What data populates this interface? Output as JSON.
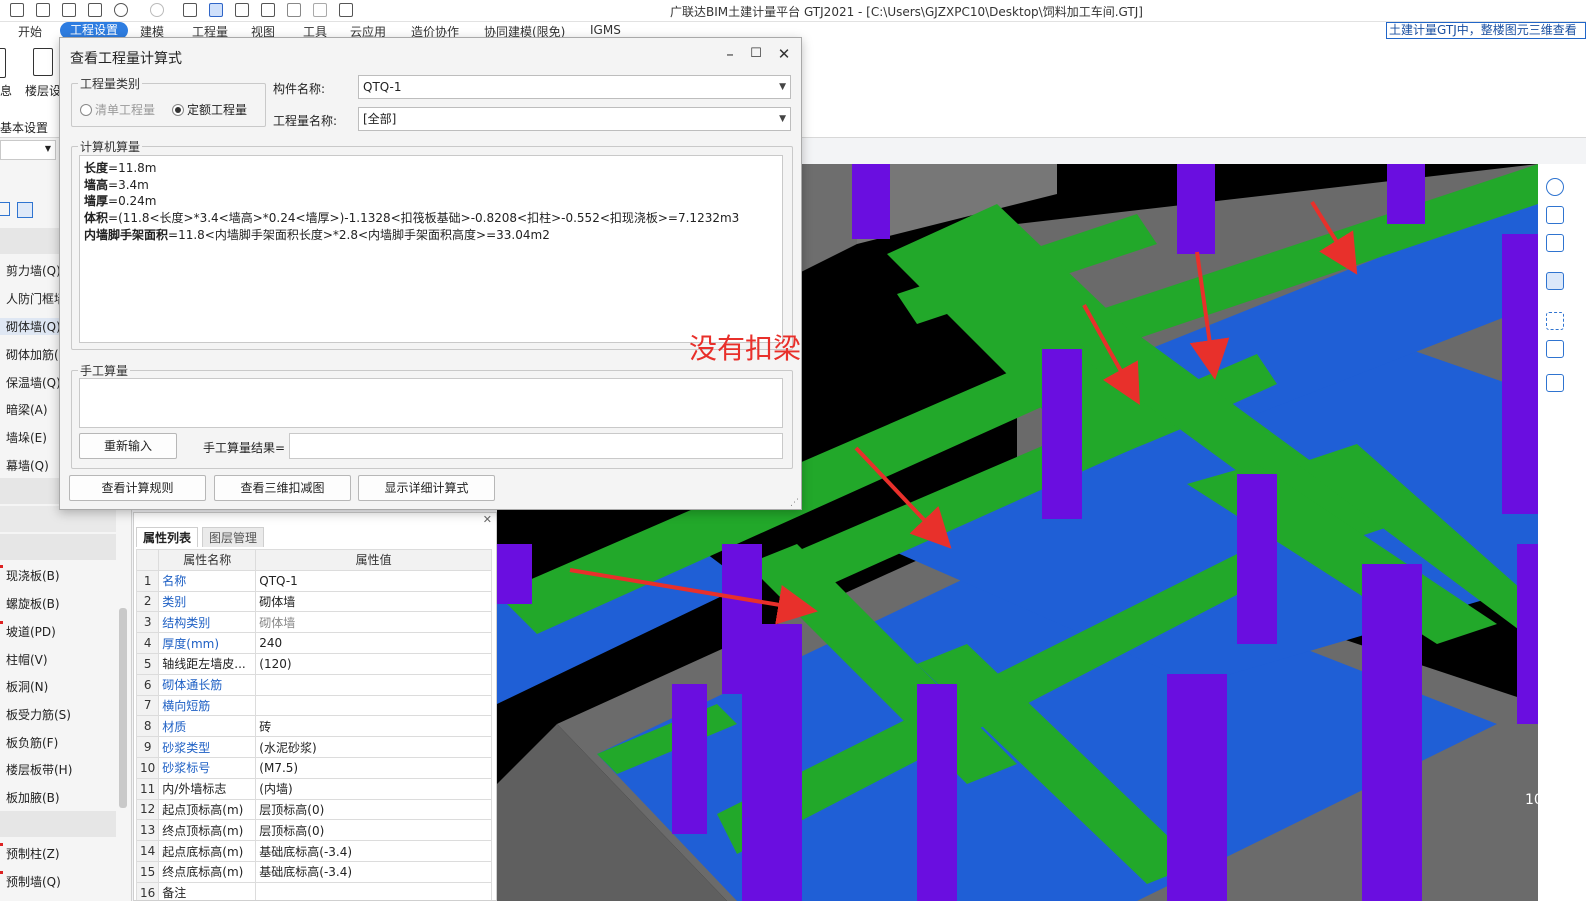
{
  "window": {
    "title": "广联达BIM土建计量平台 GTJ2021 - [C:\\Users\\GJZXPC10\\Desktop\\饲料加工车间.GTJ]"
  },
  "menu": [
    "开始",
    "工程设置",
    "建模",
    "工程量",
    "视图",
    "工具",
    "云应用",
    "造价协作",
    "协同建模(限免)",
    "IGMS"
  ],
  "menu_active": "工程设置",
  "hint_text": "土建计量GTJ中，整楼图元三维查看",
  "ribbon": {
    "items": [
      "息",
      "楼层设"
    ],
    "group_label": "基本设置"
  },
  "left_panel": {
    "items": [
      "剪力墙(Q)",
      "人防门框墙",
      "砌体墙(Q)",
      "砌体加筋(",
      "保温墙(Q)",
      "暗梁(A)",
      "墙垛(E)",
      "幕墙(Q)",
      "现浇板(B)",
      "螺旋板(B)",
      "坡道(PD)",
      "柱帽(V)",
      "板洞(N)",
      "板受力筋(S)",
      "板负筋(F)",
      "楼层板带(H)",
      "板加腋(B)",
      "预制柱(Z)",
      "预制墙(Q)"
    ],
    "selected": "砌体墙(Q)"
  },
  "dialog": {
    "title": "查看工程量计算式",
    "category_legend": "工程量类别",
    "radio_list": "清单工程量",
    "radio_quota": "定额工程量",
    "component_label": "构件名称:",
    "component_value": "QTQ-1",
    "quantity_label": "工程量名称:",
    "quantity_value": "[全部]",
    "computed_legend": "计算机算量",
    "lines": [
      {
        "name": "长度",
        "expr": "=11.8m"
      },
      {
        "name": "墙高",
        "expr": "=3.4m"
      },
      {
        "name": "墙厚",
        "expr": "=0.24m"
      },
      {
        "name": "体积",
        "expr": "=(11.8<长度>*3.4<墙高>*0.24<墙厚>)-1.1328<扣筏板基础>-0.8208<扣柱>-0.552<扣现浇板>=7.1232m3"
      },
      {
        "name": "内墙脚手架面积",
        "expr": "=11.8<内墙脚手架面积长度>*2.8<内墙脚手架面积高度>=33.04m2"
      }
    ],
    "manual_legend": "手工算量",
    "reinput_btn": "重新输入",
    "manual_result_label": "手工算量结果=",
    "btn_rules": "查看计算规则",
    "btn_3d": "查看三维扣减图",
    "btn_detail": "显示详细计算式"
  },
  "annotation": "没有扣梁",
  "props": {
    "tab_props": "属性列表",
    "tab_layers": "图层管理",
    "col_name": "属性名称",
    "col_value": "属性值",
    "rows": [
      {
        "n": "1",
        "name": "名称",
        "value": "QTQ-1",
        "blue": true
      },
      {
        "n": "2",
        "name": "类别",
        "value": "砌体墙",
        "blue": true
      },
      {
        "n": "3",
        "name": "结构类别",
        "value": "砌体墙",
        "blue": true,
        "gray": true
      },
      {
        "n": "4",
        "name": "厚度(mm)",
        "value": "240",
        "blue": true
      },
      {
        "n": "5",
        "name": "轴线距左墙皮...",
        "value": "(120)",
        "blue": false
      },
      {
        "n": "6",
        "name": "砌体通长筋",
        "value": "",
        "blue": true
      },
      {
        "n": "7",
        "name": "横向短筋",
        "value": "",
        "blue": true
      },
      {
        "n": "8",
        "name": "材质",
        "value": "砖",
        "blue": true
      },
      {
        "n": "9",
        "name": "砂浆类型",
        "value": "(水泥砂浆)",
        "blue": true
      },
      {
        "n": "10",
        "name": "砂浆标号",
        "value": "(M7.5)",
        "blue": true
      },
      {
        "n": "11",
        "name": "内/外墙标志",
        "value": "(内墙)",
        "blue": false
      },
      {
        "n": "12",
        "name": "起点顶标高(m)",
        "value": "层顶标高(0)",
        "blue": false
      },
      {
        "n": "13",
        "name": "终点顶标高(m)",
        "value": "层顶标高(0)",
        "blue": false
      },
      {
        "n": "14",
        "name": "起点底标高(m)",
        "value": "基础底标高(-3.4)",
        "blue": false
      },
      {
        "n": "15",
        "name": "终点底标高(m)",
        "value": "基础底标高(-3.4)",
        "blue": false
      },
      {
        "n": "16",
        "name": "备注",
        "value": "",
        "blue": false
      }
    ]
  },
  "viewport": {
    "axis_label": "10",
    "colors": {
      "column": "#6a0ee0",
      "beam": "#22a82a",
      "slab": "#1f5fd6",
      "wall": "#6e6e6e",
      "background": "#000000",
      "annotation": "#e8302b"
    }
  }
}
